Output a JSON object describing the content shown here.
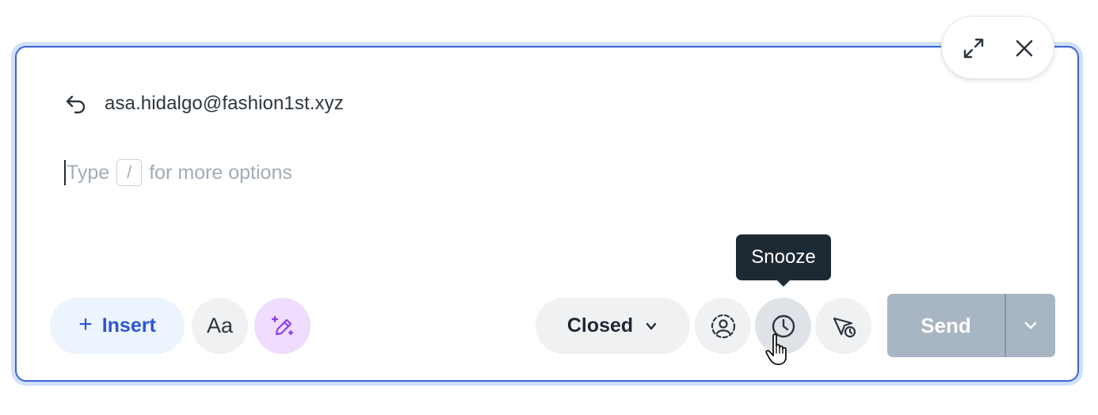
{
  "composer": {
    "recipient": "asa.hidalgo@fashion1st.xyz",
    "editor": {
      "placeholder_before": "Type",
      "placeholder_key": "/",
      "placeholder_after": "for more options"
    }
  },
  "window_controls": {
    "expand_icon": "expand-arrows-icon",
    "close_icon": "close-icon"
  },
  "toolbar": {
    "insert_label": "Insert",
    "insert_icon": "plus",
    "format_label": "Aa",
    "ai_icon": "magic-pen-icon",
    "status_label": "Closed",
    "assign_icon": "user-assign-icon",
    "snooze_icon": "clock-icon",
    "schedule_icon": "send-later-icon",
    "send_label": "Send"
  },
  "tooltip": {
    "label": "Snooze"
  },
  "colors": {
    "accent": "#3b63d6",
    "insert_text": "#2f55d4",
    "ai_bg": "#f0dcfd",
    "ai_icon": "#8a3ff0",
    "send_disabled_bg": "#a8b5c2",
    "tooltip_bg": "#1e2a33"
  }
}
